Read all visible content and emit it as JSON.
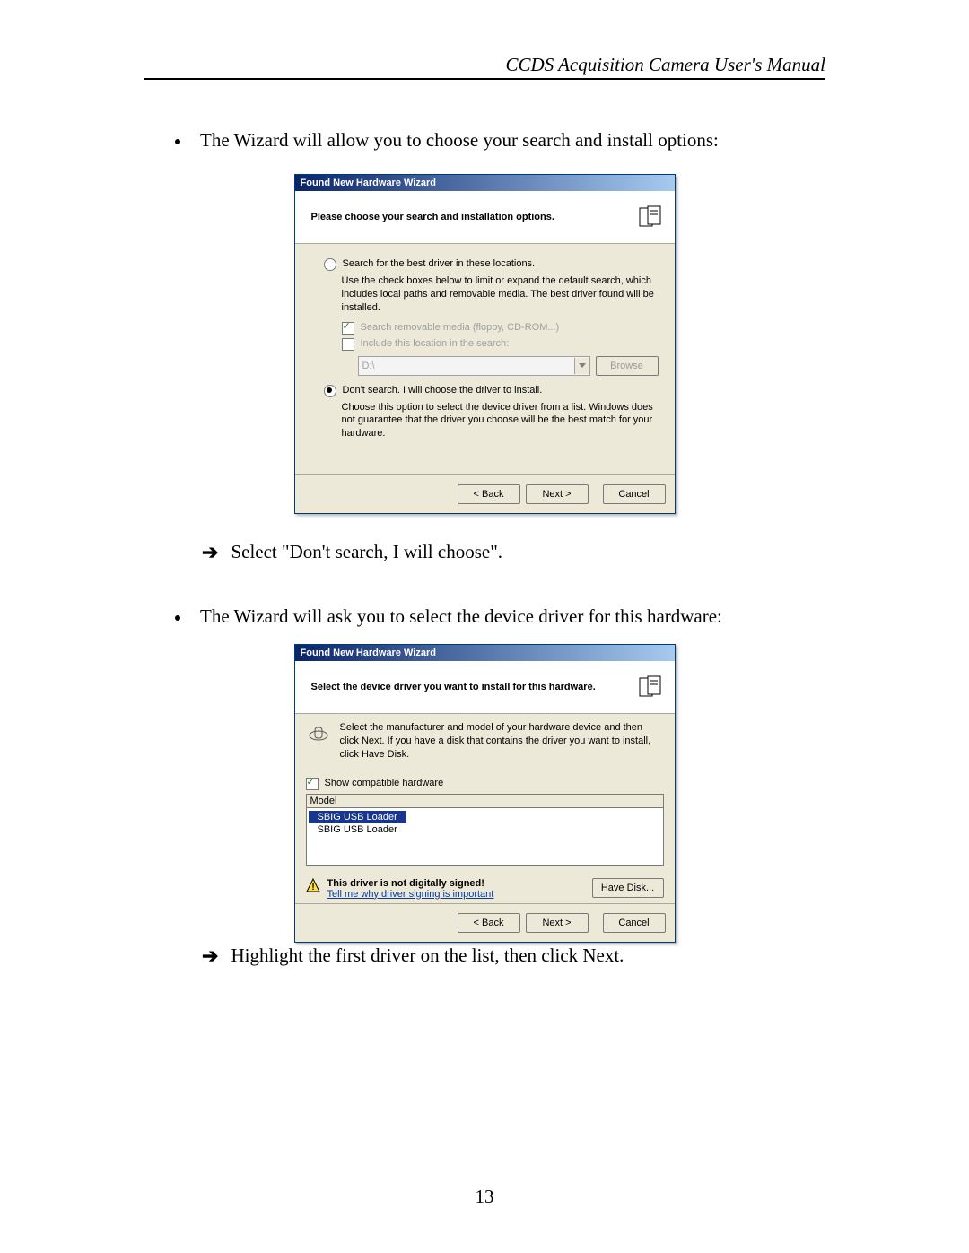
{
  "header": {
    "title": "CCDS Acquisition Camera User's Manual"
  },
  "intro1": "The Wizard will allow you to choose your search and install options:",
  "dialog1": {
    "title": "Found New Hardware Wizard",
    "heading": "Please choose your search and installation options.",
    "radio_search": "Search for the best driver in these locations.",
    "search_hint": "Use the check boxes below to limit or expand the default search, which includes local paths and removable media. The best driver found will be installed.",
    "chk_media": "Search removable media (floppy, CD-ROM...)",
    "chk_include": "Include this location in the search:",
    "path_value": "D:\\",
    "browse": "Browse",
    "radio_dont": "Don't search. I will choose the driver to install.",
    "dont_hint": "Choose this option to select the device driver from a list.  Windows does not guarantee that the driver you choose will be the best match for your hardware.",
    "back": "< Back",
    "next": "Next >",
    "cancel": "Cancel"
  },
  "action1": "Select \"Don't search, I will choose\".",
  "intro2": "The Wizard will ask you to select the device driver for this hardware:",
  "dialog2": {
    "title": "Found New Hardware Wizard",
    "heading": "Select the device driver you want to install for this hardware.",
    "instr": "Select the manufacturer and model of your hardware device and then click Next. If you have a disk that contains the driver you want to install, click Have Disk.",
    "chk_compat": "Show compatible hardware",
    "col_model": "Model",
    "item1": "SBIG USB Loader",
    "item2": "SBIG USB Loader",
    "warn_title": "This driver is not digitally signed!",
    "warn_link": "Tell me why driver signing is important",
    "have_disk": "Have Disk...",
    "back": "< Back",
    "next": "Next >",
    "cancel": "Cancel"
  },
  "action2": "Highlight the first driver on the list, then click Next.",
  "page_number": "13"
}
